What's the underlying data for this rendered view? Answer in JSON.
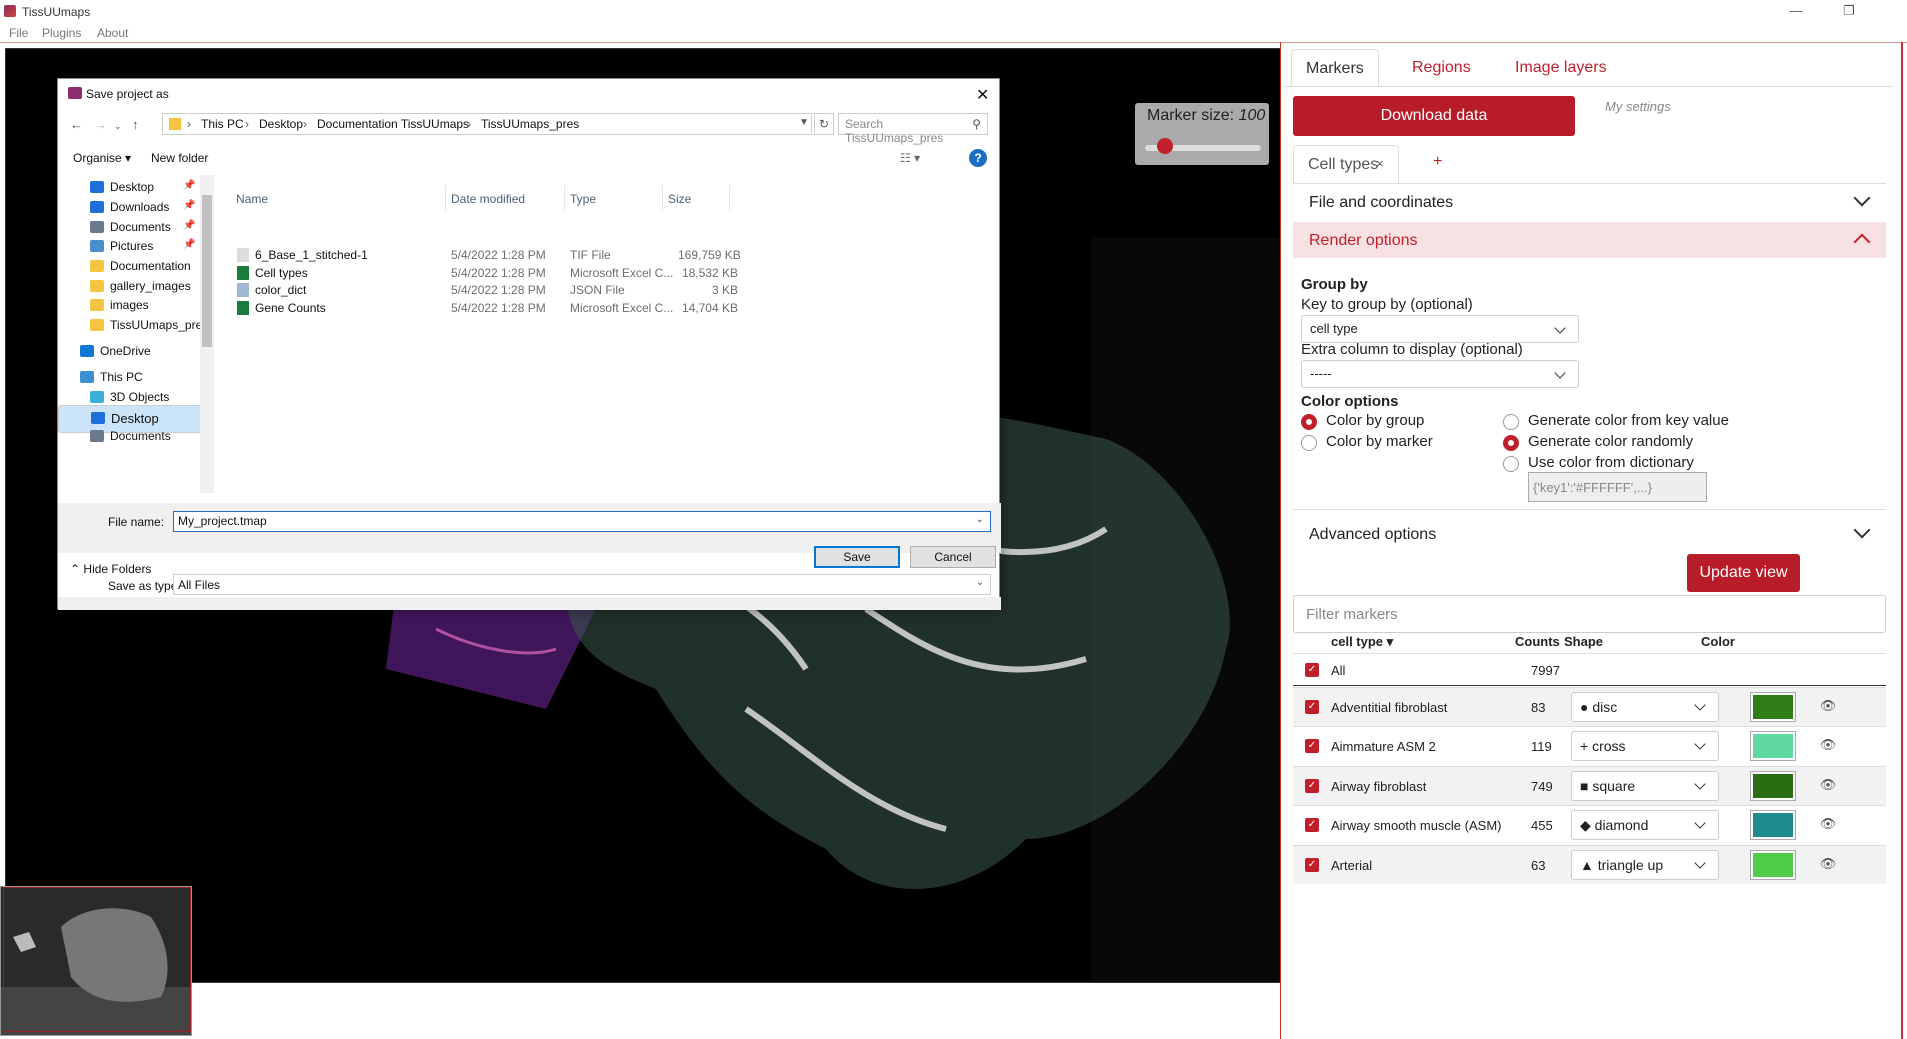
{
  "app": {
    "title": "TissUUmaps",
    "menu": [
      "File",
      "Plugins",
      "About"
    ]
  },
  "viewer": {
    "marker_size_label": "Marker size:",
    "marker_size_value": "100",
    "marker_size_fraction": 0.1
  },
  "dialog": {
    "title": "Save project as",
    "breadcrumbs": [
      "This PC",
      "Desktop",
      "Documentation TissUUmaps",
      "TissUUmaps_pres"
    ],
    "search_placeholder": "Search TissUUmaps_pres",
    "organise_label": "Organise ▾",
    "new_folder_label": "New folder",
    "nav_items": [
      {
        "label": "Desktop",
        "icon": "desktop-icon",
        "color": "#1e6fd9",
        "pinned": true
      },
      {
        "label": "Downloads",
        "icon": "download-icon",
        "color": "#1e6fd9",
        "pinned": true
      },
      {
        "label": "Documents",
        "icon": "document-icon",
        "color": "#6a7a8a",
        "pinned": true
      },
      {
        "label": "Pictures",
        "icon": "pictures-icon",
        "color": "#4a8fcc",
        "pinned": true
      },
      {
        "label": "Documentation",
        "icon": "folder-icon",
        "color": "#f5c542",
        "pinned": false
      },
      {
        "label": "gallery_images",
        "icon": "folder-icon",
        "color": "#f5c542",
        "pinned": false
      },
      {
        "label": "images",
        "icon": "folder-icon",
        "color": "#f5c542",
        "pinned": false
      },
      {
        "label": "TissUUmaps_pre",
        "icon": "folder-icon",
        "color": "#f5c542",
        "pinned": false
      },
      {
        "label": "OneDrive",
        "icon": "cloud-icon",
        "color": "#0f78d4",
        "pinned": false
      },
      {
        "label": "This PC",
        "icon": "computer-icon",
        "color": "#3a90d0",
        "pinned": false
      },
      {
        "label": "3D Objects",
        "icon": "cube-icon",
        "color": "#3ab0d8",
        "pinned": false
      },
      {
        "label": "Desktop",
        "icon": "desktop-icon",
        "color": "#1e6fd9",
        "pinned": false
      },
      {
        "label": "Documents",
        "icon": "document-icon",
        "color": "#6a7a8a",
        "pinned": false
      }
    ],
    "columns": [
      "Name",
      "Date modified",
      "Type",
      "Size"
    ],
    "files": [
      {
        "name": "6_Base_1_stitched-1",
        "date": "5/4/2022 1:28 PM",
        "type": "TIF File",
        "size": "169,759 KB",
        "icon": "tif-file-icon",
        "color": "#dcdcdc"
      },
      {
        "name": "Cell types",
        "date": "5/4/2022 1:28 PM",
        "type": "Microsoft Excel C...",
        "size": "18,532 KB",
        "icon": "excel-file-icon",
        "color": "#1d7a3e"
      },
      {
        "name": "color_dict",
        "date": "5/4/2022 1:28 PM",
        "type": "JSON File",
        "size": "3 KB",
        "icon": "json-file-icon",
        "color": "#9fb7d0"
      },
      {
        "name": "Gene Counts",
        "date": "5/4/2022 1:28 PM",
        "type": "Microsoft Excel C...",
        "size": "14,704 KB",
        "icon": "excel-file-icon",
        "color": "#1d7a3e"
      }
    ],
    "file_name_label": "File name:",
    "file_name_value": "My_project.tmap",
    "save_as_type_label": "Save as type:",
    "save_as_type_value": "All Files",
    "hide_folders": "Hide Folders",
    "save_label": "Save",
    "cancel_label": "Cancel"
  },
  "panel": {
    "tabs": [
      "Markers",
      "Regions",
      "Image layers"
    ],
    "download_label": "Download data",
    "my_settings": "My settings",
    "subtab_label": "Cell types",
    "subtab_close": "×",
    "add_tab": "+",
    "section_file": "File and coordinates",
    "section_render": "Render options",
    "group_by_title": "Group by",
    "key_label": "Key to group by (optional)",
    "key_value": "cell type",
    "extra_label": "Extra column to display (optional)",
    "extra_value": "-----",
    "color_options_title": "Color options",
    "color_by_group": "Color by group",
    "color_by_marker": "Color by marker",
    "gen_from_key": "Generate color from key value",
    "gen_random": "Generate color randomly",
    "use_dict": "Use color from dictionary",
    "dict_placeholder": "{'key1':'#FFFFFF',...}",
    "section_advanced": "Advanced options",
    "update_label": "Update view",
    "filter_placeholder": "Filter markers",
    "table_headers": {
      "group": "cell type ▾",
      "counts": "Counts",
      "shape": "Shape",
      "color": "Color"
    },
    "all_label": "All",
    "all_count": "7997",
    "rows": [
      {
        "name": "Adventitial fibroblast",
        "count": "83",
        "shape": "● disc",
        "color": "#2e7d16"
      },
      {
        "name": "Aimmature ASM 2",
        "count": "119",
        "shape": "+ cross",
        "color": "#5fd9a0"
      },
      {
        "name": "Airway fibroblast",
        "count": "749",
        "shape": "■ square",
        "color": "#2a6e14"
      },
      {
        "name": "Airway smooth muscle (ASM)",
        "count": "455",
        "shape": "◆ diamond",
        "color": "#1f8a8c"
      },
      {
        "name": "Arterial",
        "count": "63",
        "shape": "▲ triangle up",
        "color": "#4fcc4a"
      }
    ]
  }
}
